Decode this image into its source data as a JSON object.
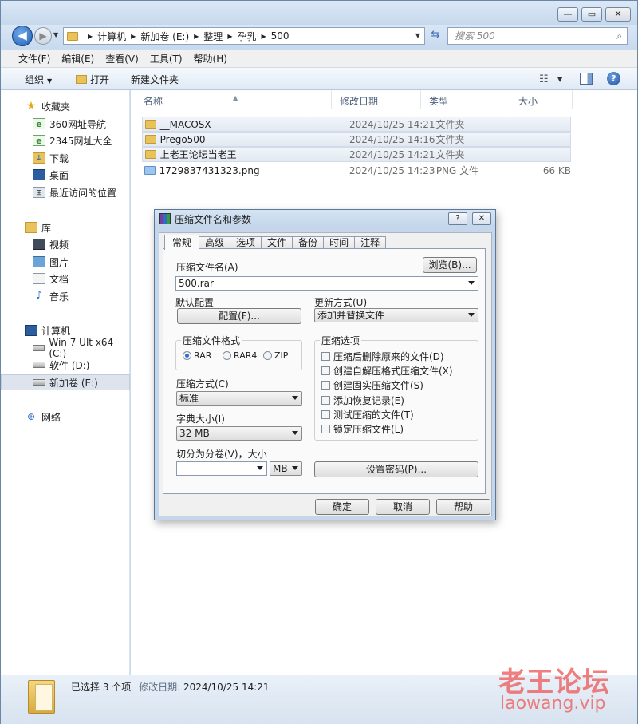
{
  "explorer": {
    "window_buttons": {
      "minimize": "—",
      "maximize": "▭",
      "close": "✕"
    },
    "breadcrumb": [
      "计算机",
      "新加卷 (E:)",
      "整理",
      "孕乳",
      "500"
    ],
    "search_placeholder": "搜索 500",
    "menu": [
      "文件(F)",
      "编辑(E)",
      "查看(V)",
      "工具(T)",
      "帮助(H)"
    ],
    "toolbar": {
      "organize": "组织",
      "open": "打开",
      "new_folder": "新建文件夹"
    },
    "nav": {
      "favorites": "收藏夹",
      "fav_items": [
        "360网址导航",
        "2345网址大全",
        "下载",
        "桌面",
        "最近访问的位置"
      ],
      "libraries": "库",
      "lib_items": [
        "视频",
        "图片",
        "文档",
        "音乐"
      ],
      "computer": "计算机",
      "drives": [
        "Win 7 Ult x64 (C:)",
        "软件 (D:)",
        "新加卷 (E:)"
      ],
      "network": "网络"
    },
    "columns": {
      "name": "名称",
      "date": "修改日期",
      "type": "类型",
      "size": "大小"
    },
    "files": [
      {
        "name": "__MACOSX",
        "date": "2024/10/25 14:21",
        "type": "文件夹",
        "size": ""
      },
      {
        "name": "Prego500",
        "date": "2024/10/25 14:16",
        "type": "文件夹",
        "size": ""
      },
      {
        "name": "上老王论坛当老王",
        "date": "2024/10/25 14:21",
        "type": "文件夹",
        "size": ""
      },
      {
        "name": "1729837431323.png",
        "date": "2024/10/25 14:23",
        "type": "PNG 文件",
        "size": "66 KB"
      }
    ],
    "status": {
      "selected": "已选择 3 个项",
      "date_label": "修改日期:",
      "date_value": "2024/10/25 14:21"
    }
  },
  "watermark": {
    "cn": "老王论坛",
    "en": "laowang.vip"
  },
  "dialog": {
    "title": "压缩文件名和参数",
    "help_btn": "?",
    "close_btn": "✕",
    "tabs": [
      "常规",
      "高级",
      "选项",
      "文件",
      "备份",
      "时间",
      "注释"
    ],
    "archive_name_label": "压缩文件名(A)",
    "browse_button": "浏览(B)...",
    "archive_name_value": "500.rar",
    "default_profile_label": "默认配置",
    "profiles_button": "配置(F)...",
    "update_mode_label": "更新方式(U)",
    "update_mode_value": "添加并替换文件",
    "format_group": "压缩文件格式",
    "formats": [
      "RAR",
      "RAR4",
      "ZIP"
    ],
    "method_label": "压缩方式(C)",
    "method_value": "标准",
    "dict_label": "字典大小(I)",
    "dict_value": "32 MB",
    "split_label": "切分为分卷(V)，大小",
    "split_unit": "MB",
    "options_group": "压缩选项",
    "options": [
      "压缩后删除原来的文件(D)",
      "创建自解压格式压缩文件(X)",
      "创建固实压缩文件(S)",
      "添加恢复记录(E)",
      "测试压缩的文件(T)",
      "锁定压缩文件(L)"
    ],
    "password_button": "设置密码(P)...",
    "ok": "确定",
    "cancel": "取消",
    "help": "帮助"
  }
}
